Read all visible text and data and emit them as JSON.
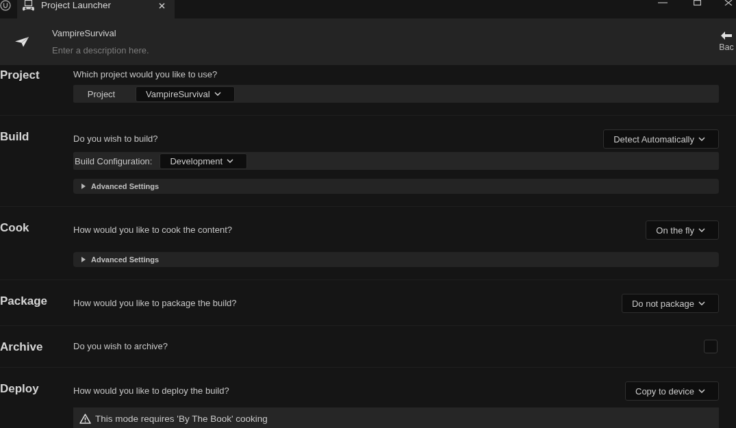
{
  "title_bar": {
    "tabs": [
      {
        "title": "Project Launcher",
        "selected": true
      }
    ]
  },
  "header": {
    "name": "VampireSurvival",
    "description": {
      "placeholder": "Enter a description here."
    },
    "back_button": {
      "label": "Bac"
    }
  },
  "sections": [
    {
      "title": "Project",
      "question": "Which project would you like to use?",
      "rows": [
        {
          "kind": "field",
          "label": "Project",
          "value": "VampireSurvival"
        }
      ]
    },
    {
      "title": "Build",
      "question": "Do you wish to build?",
      "control": {
        "kind": "dropdown",
        "value": "Detect Automatically"
      },
      "rows": [
        {
          "kind": "field",
          "label": "Build Configuration:",
          "value": "Development"
        },
        {
          "kind": "expander",
          "label": "Advanced Settings",
          "expanded": false
        }
      ]
    },
    {
      "title": "Cook",
      "question": "How would you like to cook the content?",
      "control": {
        "kind": "dropdown",
        "value": "On the fly"
      },
      "rows": [
        {
          "kind": "expander",
          "label": "Advanced Settings",
          "expanded": false
        }
      ]
    },
    {
      "title": "Package",
      "question": "How would you like to package the build?",
      "control": {
        "kind": "dropdown",
        "value": "Do not package"
      }
    },
    {
      "title": "Archive",
      "question": "Do you wish to archive?",
      "control": {
        "kind": "checkbox",
        "checked": false
      }
    },
    {
      "title": "Deploy",
      "question": "How would you like to deploy the build?",
      "control": {
        "kind": "dropdown",
        "value": "Copy to device"
      },
      "rows": [
        {
          "kind": "warning",
          "text": "This mode requires 'By The Book' cooking"
        }
      ]
    }
  ]
}
